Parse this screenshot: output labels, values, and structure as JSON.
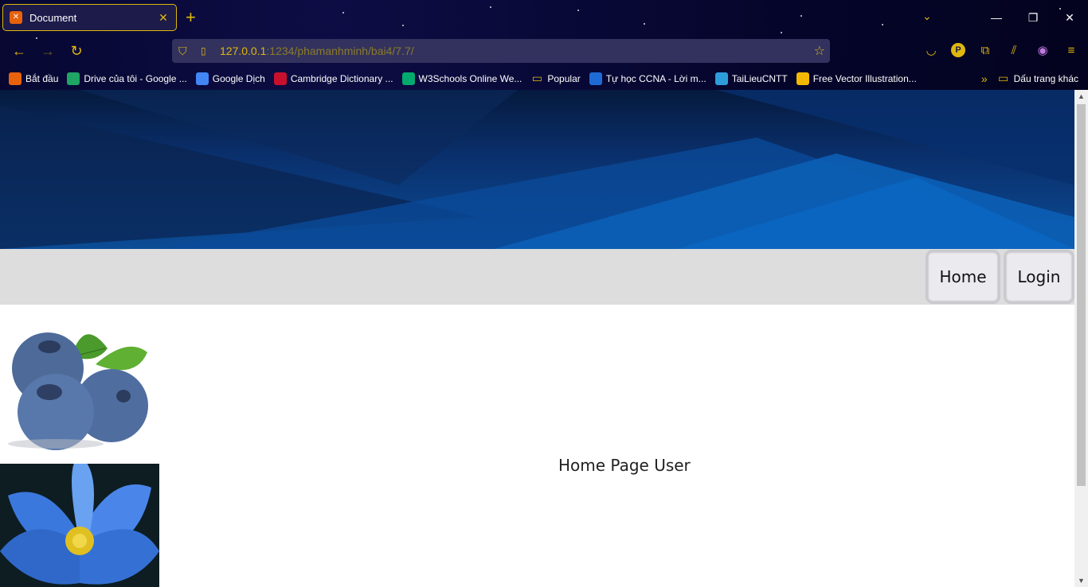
{
  "browser": {
    "tab_title": "Document",
    "tab_favicon": "xampp-icon",
    "url_host": "127.0.0.1",
    "url_path": ":1234/phamanhminh/bai4/7.7/",
    "accent_color": "#e0b80c",
    "profile_letter": "P"
  },
  "bookmarks": [
    {
      "label": "Bắt đầu",
      "icon": "firefox-icon",
      "color": "#e8620c"
    },
    {
      "label": "Drive của tôi - Google ...",
      "icon": "google-drive-icon",
      "color": "#1fa463"
    },
    {
      "label": "Google Dịch",
      "icon": "google-translate-icon",
      "color": "#4285f4"
    },
    {
      "label": "Cambridge Dictionary ...",
      "icon": "cambridge-icon",
      "color": "#c8102e"
    },
    {
      "label": "W3Schools Online We...",
      "icon": "w3schools-icon",
      "color": "#04aa6d"
    },
    {
      "label": "Popular",
      "icon": "folder-icon",
      "color": "#e0b80c"
    },
    {
      "label": "Tự học CCNA - Lời m...",
      "icon": "ccna-icon",
      "color": "#1e6bd6"
    },
    {
      "label": "TaiLieuCNTT",
      "icon": "tailieucntt-icon",
      "color": "#2d9cdb"
    },
    {
      "label": "Free Vector Illustration...",
      "icon": "freepik-icon",
      "color": "#f5b800"
    }
  ],
  "bookmarks_other": "Dấu trang khác",
  "page": {
    "nav": {
      "home": "Home",
      "login": "Login"
    },
    "caption": "Home Page User",
    "images": [
      "blueberries-image",
      "blue-lotus-image"
    ]
  }
}
